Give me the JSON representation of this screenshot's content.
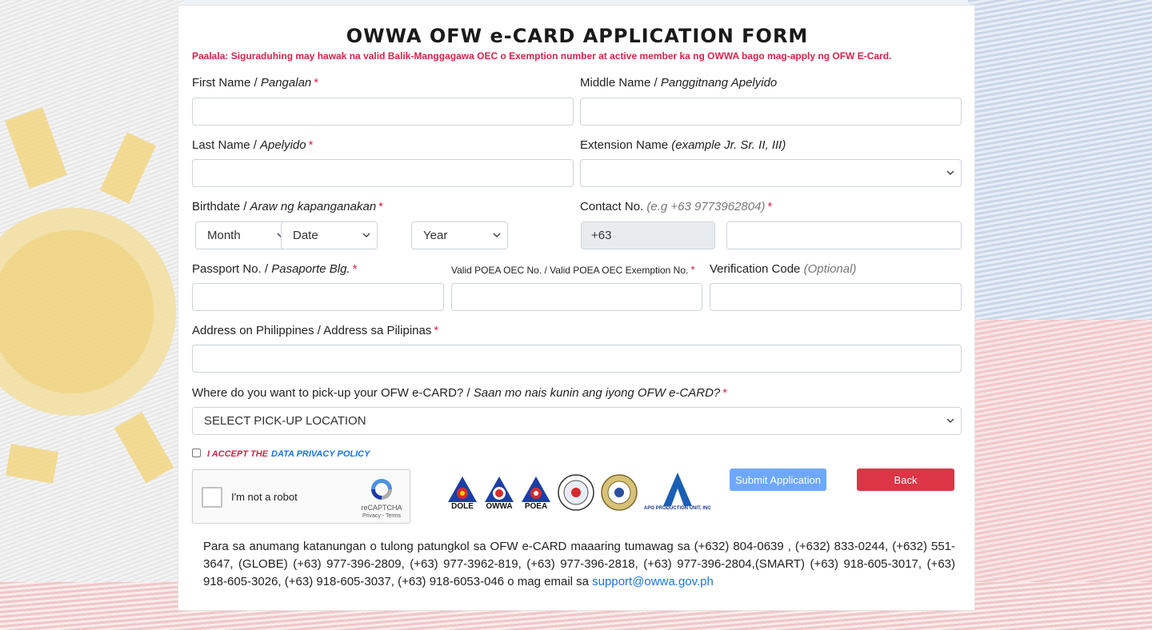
{
  "form": {
    "title": "OWWA OFW e-CARD APPLICATION FORM",
    "reminder": "Paalala: Siguraduhing may hawak na valid Balik-Manggagawa OEC o Exemption number at active member ka ng OWWA bago mag-apply ng OFW E-Card.",
    "required_mark": "*"
  },
  "fields": {
    "first_name": {
      "label": "First Name /",
      "label_alt": "Pangalan",
      "value": ""
    },
    "middle_name": {
      "label": "Middle Name /",
      "label_alt": "Panggitnang Apelyido",
      "value": ""
    },
    "last_name": {
      "label": "Last Name /",
      "label_alt": "Apelyido",
      "value": ""
    },
    "extension_name": {
      "label": "Extension Name",
      "hint": "(example Jr. Sr. II, III)",
      "value": ""
    },
    "birthdate": {
      "label": "Birthdate /",
      "label_alt": "Araw ng kapanganakan",
      "month": "Month",
      "date": "Date",
      "year": "Year"
    },
    "contact": {
      "label": "Contact No.",
      "hint": "(e.g +63 9773962804)",
      "prefix": "+63",
      "value": ""
    },
    "passport": {
      "label": "Passport No. /",
      "label_alt": "Pasaporte Blg.",
      "value": ""
    },
    "oec": {
      "label": "Valid POEA OEC No. / Valid POEA OEC Exemption No.",
      "value": ""
    },
    "verification": {
      "label": "Verification Code",
      "hint": "(Optional)",
      "value": ""
    },
    "address": {
      "label": "Address on Philippines / Address sa Pilipinas",
      "value": ""
    },
    "pickup": {
      "label": "Where do you want to pick-up your OFW e-CARD? /",
      "label_alt": "Saan mo nais kunin ang iyong OFW e-CARD?",
      "selected": "SELECT PICK-UP LOCATION"
    }
  },
  "privacy": {
    "accept": "I ACCEPT THE",
    "link": "DATA PRIVACY POLICY",
    "checked": false
  },
  "recaptcha": {
    "label": "I'm not a robot",
    "brand": "reCAPTCHA",
    "terms": "Privacy - Terms"
  },
  "logos": [
    {
      "caption": "DOLE"
    },
    {
      "caption": "OWWA"
    },
    {
      "caption": "POEA"
    },
    {
      "caption": ""
    },
    {
      "caption": ""
    },
    {
      "caption": "APO PRODUCTION UNIT, INC"
    }
  ],
  "buttons": {
    "submit": "Submit Application",
    "back": "Back"
  },
  "footer": {
    "text": "Para sa anumang katanungan o tulong patungkol sa OFW e-CARD maaaring tumawag sa (+632) 804-0639 , (+632) 833-0244, (+632) 551-3647, (GLOBE) (+63) 977-396-2809, (+63) 977-3962-819, (+63) 977-396-2818, (+63) 977-396-2804,(SMART) (+63) 918-605-3017, (+63) 918-605-3026, (+63) 918-605-3037, (+63) 918-6053-046 o mag email sa",
    "email": "support@owwa.gov.ph"
  },
  "colors": {
    "required": "#d9224b",
    "submit": "#6ea8fe",
    "back": "#dc3545",
    "link": "#1a73e8"
  }
}
